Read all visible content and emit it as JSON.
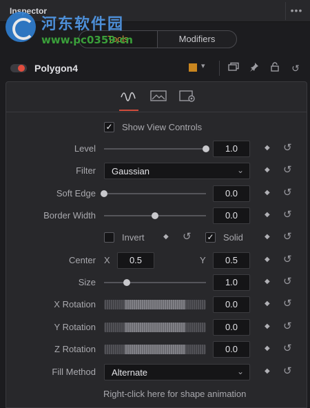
{
  "panel_title": "Inspector",
  "more_label": "•••",
  "tabs": {
    "tools": "Tools",
    "modifiers": "Modifiers"
  },
  "watermark": {
    "line1": "河东软件园",
    "line2": "www.pc0359.cn"
  },
  "node": {
    "name": "Polygon4",
    "color": "#c9861f",
    "enabled": true
  },
  "subtabs": [
    {
      "icon": "spline-icon",
      "active": true
    },
    {
      "icon": "image-icon",
      "active": false
    },
    {
      "icon": "settings-icon",
      "active": false
    }
  ],
  "controls": {
    "show_view_controls": {
      "label": "Show View Controls",
      "checked": true
    },
    "level": {
      "label": "Level",
      "value": "1.0",
      "fraction": 1.0
    },
    "filter": {
      "label": "Filter",
      "value": "Gaussian"
    },
    "soft_edge": {
      "label": "Soft Edge",
      "value": "0.0",
      "fraction": 0.0
    },
    "border_width": {
      "label": "Border Width",
      "value": "0.0",
      "fraction": 0.5
    },
    "invert": {
      "label": "Invert",
      "checked": false
    },
    "solid": {
      "label": "Solid",
      "checked": true
    },
    "center": {
      "label": "Center",
      "x_axis": "X",
      "x": "0.5",
      "y_axis": "Y",
      "y": "0.5"
    },
    "size": {
      "label": "Size",
      "value": "1.0",
      "fraction": 0.2
    },
    "x_rotation": {
      "label": "X Rotation",
      "value": "0.0"
    },
    "y_rotation": {
      "label": "Y Rotation",
      "value": "0.0"
    },
    "z_rotation": {
      "label": "Z Rotation",
      "value": "0.0"
    },
    "fill_method": {
      "label": "Fill Method",
      "value": "Alternate"
    }
  },
  "hint": "Right-click here for shape animation",
  "accent_color": "#d04c3c",
  "tab_active_color": "#d99a3d"
}
